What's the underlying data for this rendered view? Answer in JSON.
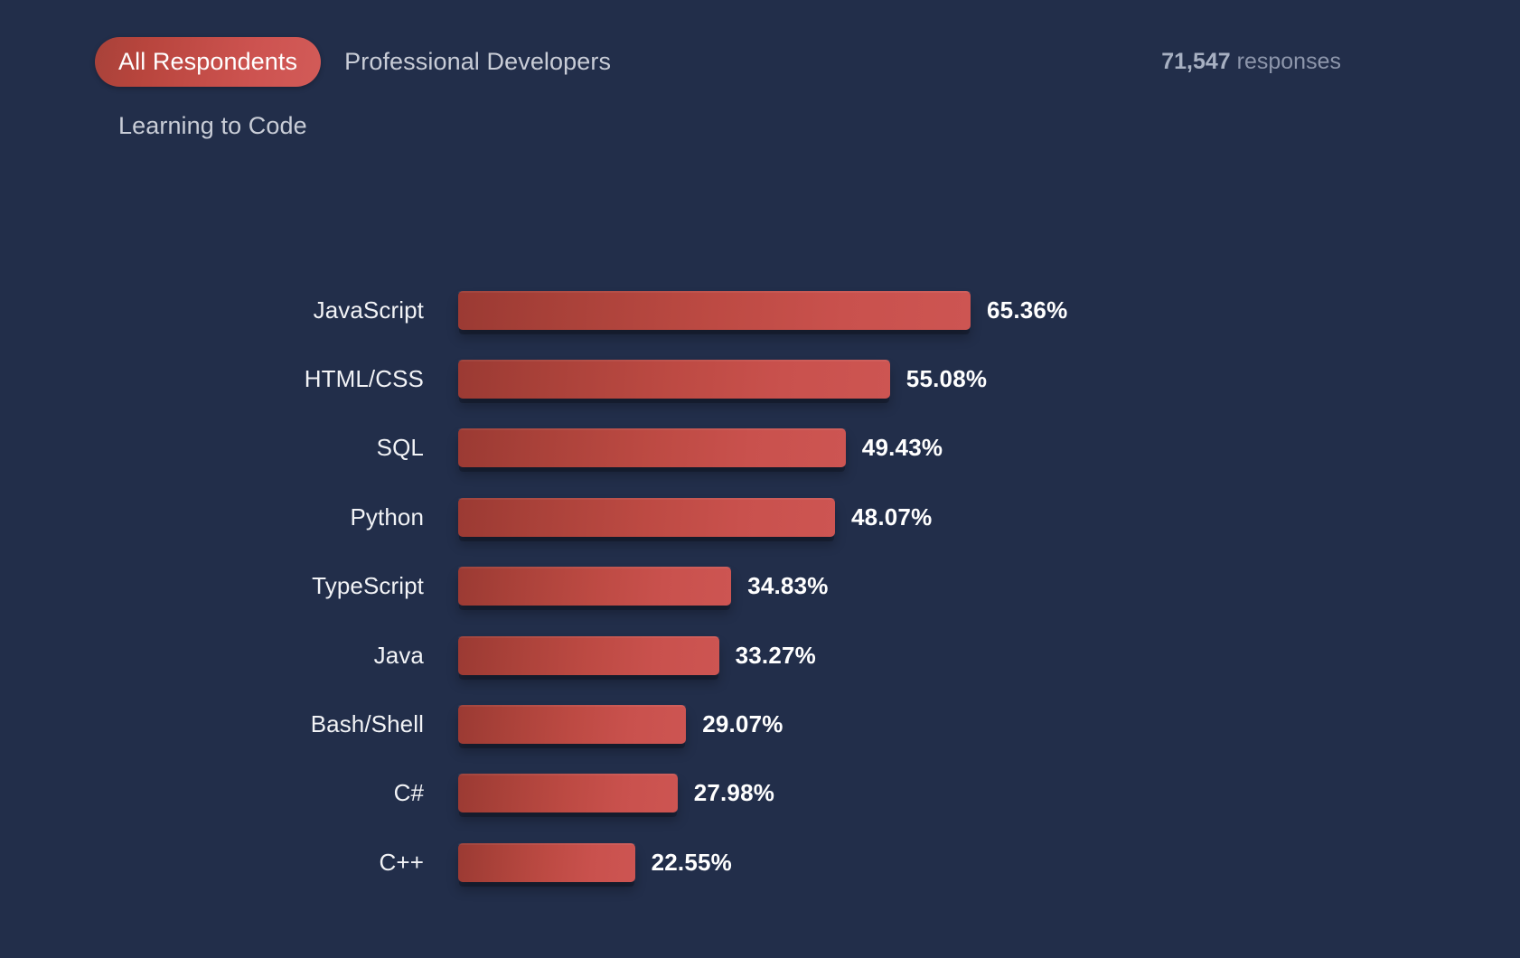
{
  "theme": {
    "background": "#222e4a",
    "accent": "#cd5350",
    "accent_dark": "#9b3a33",
    "text": "#ffffff",
    "muted_text": "#c9cdd7",
    "responses_text": "#8d96ab"
  },
  "tabs": [
    {
      "label": "All Respondents",
      "active": true
    },
    {
      "label": "Professional Developers",
      "active": false
    },
    {
      "label": "Learning to Code",
      "active": false
    }
  ],
  "responses": {
    "count": "71,547",
    "suffix": " responses"
  },
  "chart_data": {
    "type": "bar",
    "orientation": "horizontal",
    "title": "",
    "subtitle": "",
    "xlabel": "",
    "ylabel": "",
    "xlim": [
      0,
      65.36
    ],
    "grid": false,
    "legend": false,
    "value_suffix": "%",
    "categories": [
      "JavaScript",
      "HTML/CSS",
      "SQL",
      "Python",
      "TypeScript",
      "Java",
      "Bash/Shell",
      "C#",
      "C++"
    ],
    "values": [
      65.36,
      55.08,
      49.43,
      48.07,
      34.83,
      33.27,
      29.07,
      27.98,
      22.55
    ],
    "value_labels": [
      "65.36%",
      "55.08%",
      "49.43%",
      "48.07%",
      "34.83%",
      "33.27%",
      "29.07%",
      "27.98%",
      "22.55%"
    ]
  }
}
